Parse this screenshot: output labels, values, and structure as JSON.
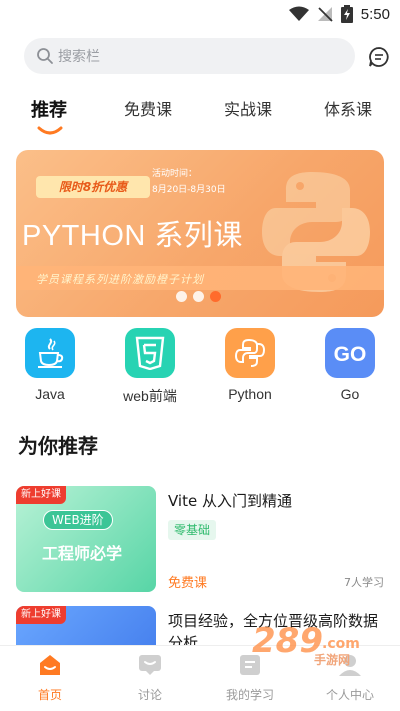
{
  "status_bar": {
    "time": "5:50"
  },
  "search": {
    "placeholder": "搜索栏"
  },
  "tabs": [
    {
      "label": "推荐",
      "active": true
    },
    {
      "label": "免费课"
    },
    {
      "label": "实战课"
    },
    {
      "label": "体系课"
    }
  ],
  "banner": {
    "promo": "限时8折优惠",
    "date_label": "活动时间：",
    "date_range": "8月20日-8月30日",
    "title": "PYTHON 系列课",
    "subtitle": "学员课程系列进阶激励橙子计划",
    "slides": 3,
    "active_slide": 3
  },
  "categories": [
    {
      "label": "Java",
      "icon": "java-icon",
      "color": "#1db5f0"
    },
    {
      "label": "web前端",
      "icon": "html5-icon",
      "color": "#27d3b3"
    },
    {
      "label": "Python",
      "icon": "python-icon",
      "color": "#ffa04a"
    },
    {
      "label": "Go",
      "icon": "go-icon",
      "color": "#5a8df6"
    }
  ],
  "section_title": "为你推荐",
  "courses": [
    {
      "badge": "新上好课",
      "thumb_tag": "WEB进阶",
      "thumb_text": "工程师必学",
      "title": "Vite 从入门到精通",
      "tag": "零基础",
      "price": "免费课",
      "learners": "7人学习"
    },
    {
      "badge": "新上好课",
      "title": "项目经验，全方位晋级高阶数据分析"
    }
  ],
  "bottom_nav": [
    {
      "label": "首页",
      "icon": "home-icon",
      "active": true
    },
    {
      "label": "讨论",
      "icon": "discussion-icon"
    },
    {
      "label": "我的学习",
      "icon": "my-learning-icon"
    },
    {
      "label": "个人中心",
      "icon": "profile-icon"
    }
  ],
  "watermark": {
    "logo": "289.com",
    "text": "手游网"
  },
  "colors": {
    "accent": "#ff7a22",
    "banner": "#f7a76b",
    "tag_green": "#2dba6c"
  }
}
